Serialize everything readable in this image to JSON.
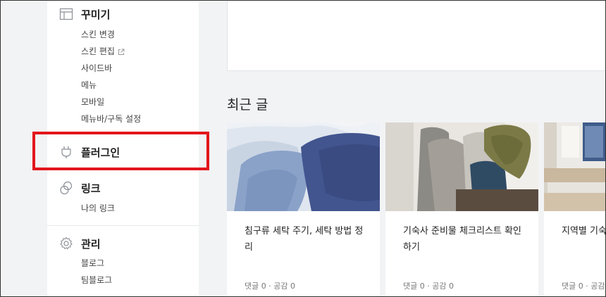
{
  "sidebar": {
    "decorate": {
      "title": "꾸미기",
      "icon": "layout-icon",
      "items": [
        "스킨 변경",
        "스킨 편집",
        "사이드바",
        "메뉴",
        "모바일",
        "메뉴바/구독 설정"
      ]
    },
    "plugin": {
      "title": "플러그인",
      "icon": "plug-icon"
    },
    "link": {
      "title": "링크",
      "icon": "link-icon",
      "items": [
        "나의 링크"
      ]
    },
    "manage": {
      "title": "관리",
      "icon": "gear-icon",
      "items": [
        "블로그",
        "팀블로그"
      ]
    }
  },
  "main": {
    "recent_title": "최근 글",
    "cards": [
      {
        "title": "침구류 세탁 주기, 세탁 방법 정리",
        "meta": "댓글 0 · 공감 0",
        "image": "bedding-photo"
      },
      {
        "title": "기숙사 준비물 체크리스트 확인하기",
        "meta": "댓글 0 · 공감 0",
        "image": "laundry-photo"
      },
      {
        "title": "지역별 기숙",
        "meta": "댓글 0 · 공감",
        "image": "dorm-room-photo"
      }
    ]
  },
  "colors": {
    "highlight": "#e2161c",
    "background": "#f2f3f5"
  }
}
